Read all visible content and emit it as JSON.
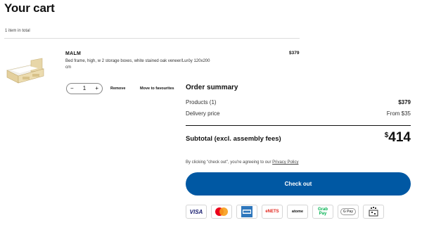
{
  "cart": {
    "title": "Your cart",
    "item_count": "1 item in total"
  },
  "item": {
    "name": "MALM",
    "description": "Bed frame, high, w 2 storage boxes, white stained oak veneer/Luröy 120x200 cm",
    "price": "$379",
    "quantity": "1",
    "minus_symbol": "−",
    "plus_symbol": "+",
    "remove_label": "Remove",
    "move_label": "Move to favourites"
  },
  "summary": {
    "title": "Order summary",
    "products_label": "Products (1)",
    "products_value": "$379",
    "delivery_label": "Delivery price",
    "delivery_value": "From $35",
    "subtotal_label": "Subtotal (excl. assembly fees)",
    "subtotal_currency": "$",
    "subtotal_amount": "414",
    "terms_prefix": "By clicking \"check out\", you're agreeing to our ",
    "terms_link": "Privacy Policy",
    "checkout_label": "Check out"
  },
  "payment": {
    "visa": "VISA",
    "nets": "eNETS",
    "atome": "atome",
    "grab_top": "Grab",
    "grab_bottom": "Pay",
    "gpay": "G Pay"
  },
  "colors": {
    "checkout": "#0058a3",
    "visa": "#1a1f71",
    "mastercard_red": "#eb001b",
    "mastercard_yellow": "#f79e1b",
    "amex": "#2e77bc",
    "nets": "#e2231a",
    "grab": "#00b14f"
  },
  "icons": {
    "product": "bed-image",
    "amex": "amex-logo",
    "mastercard": "mastercard-logo",
    "paynow": "paynow-logo"
  }
}
